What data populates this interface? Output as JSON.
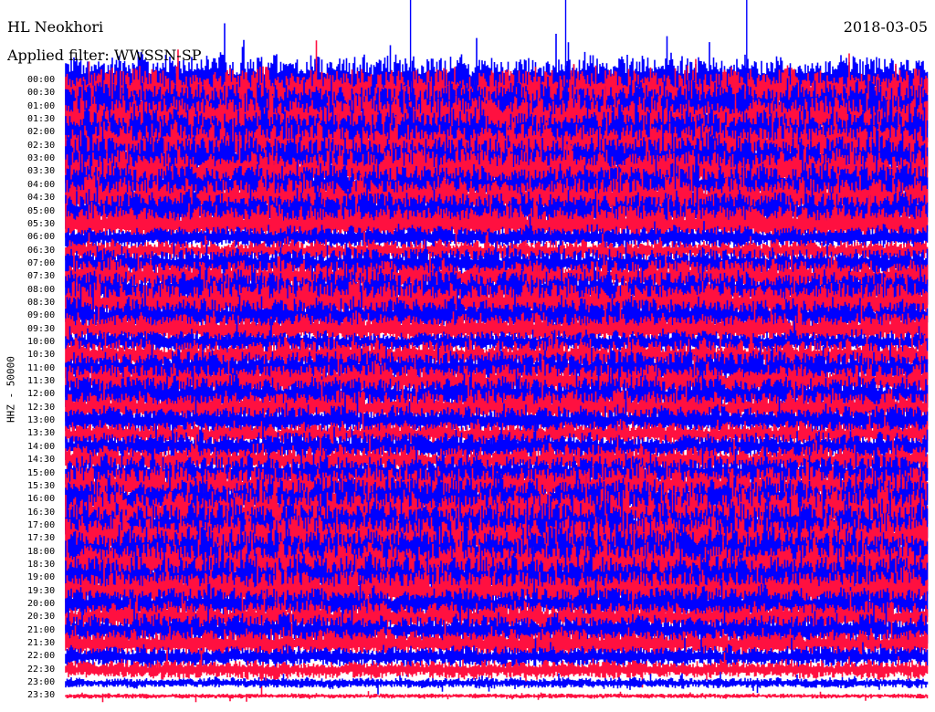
{
  "header": {
    "station": "HL Neokhori",
    "date": "2018-03-05",
    "filter": "Applied filter: WWSSN-SP"
  },
  "channel_label": "HHZ - 50000",
  "colors": {
    "trace_a": "#0000ff",
    "trace_b": "#ff1040",
    "background": "#ffffff"
  },
  "chart_data": {
    "type": "helicorder",
    "row_labels": [
      "00:00",
      "00:30",
      "01:00",
      "01:30",
      "02:00",
      "02:30",
      "03:00",
      "03:30",
      "04:00",
      "04:30",
      "05:00",
      "05:30",
      "06:00",
      "06:30",
      "07:00",
      "07:30",
      "08:00",
      "08:30",
      "09:00",
      "09:30",
      "10:00",
      "10:30",
      "11:00",
      "11:30",
      "12:00",
      "12:30",
      "13:00",
      "13:30",
      "14:00",
      "14:30",
      "15:00",
      "15:30",
      "16:00",
      "16:30",
      "17:00",
      "17:30",
      "18:00",
      "18:30",
      "19:00",
      "19:30",
      "20:00",
      "20:30",
      "21:00",
      "21:30",
      "22:00",
      "22:30",
      "23:00",
      "23:30"
    ],
    "row_minutes": 30,
    "trace_colors_alternate": [
      "#0000ff",
      "#ff1040"
    ],
    "relative_amplitude": [
      1.15,
      1.2,
      1.2,
      1.15,
      1.15,
      1.1,
      1.1,
      1.1,
      1.0,
      1.0,
      0.95,
      0.9,
      0.55,
      0.5,
      0.75,
      0.8,
      0.95,
      1.0,
      0.85,
      0.75,
      0.55,
      0.75,
      0.85,
      0.85,
      0.85,
      0.8,
      0.7,
      0.6,
      0.7,
      0.7,
      0.85,
      0.95,
      1.05,
      1.1,
      1.15,
      1.15,
      1.15,
      1.1,
      1.1,
      1.0,
      0.8,
      0.75,
      0.75,
      0.7,
      0.5,
      0.45,
      0.25,
      0.12
    ],
    "large_events": [
      {
        "row": 0,
        "x_fraction": 0.4
      },
      {
        "row": 0,
        "x_fraction": 0.58
      },
      {
        "row": 0,
        "x_fraction": 0.79
      }
    ]
  }
}
